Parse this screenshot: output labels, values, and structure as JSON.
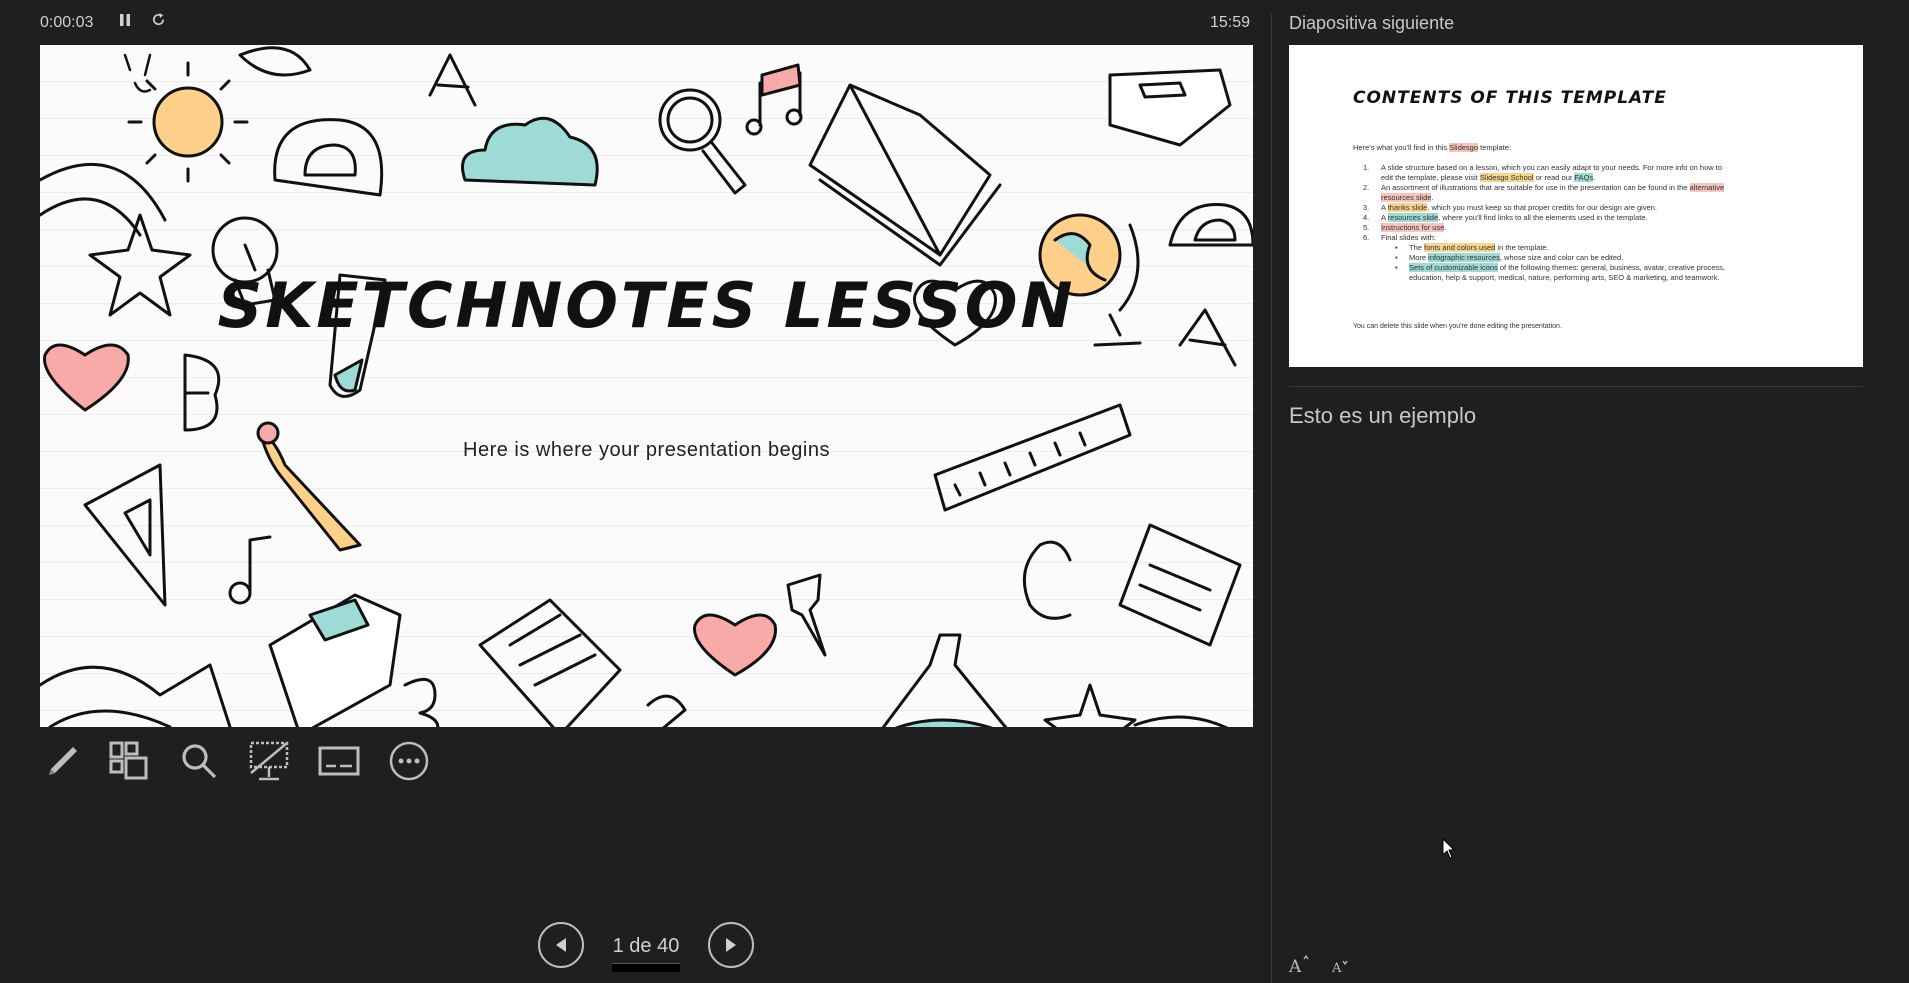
{
  "top_bar": {
    "elapsed_time": "0:00:03",
    "pause_icon": "pause-icon",
    "restart_icon": "restart-timer-icon",
    "clock": "15:59"
  },
  "current_slide": {
    "title": "Sketchnotes Lesson",
    "subtitle": "Here is where your presentation begins"
  },
  "next_slide_panel": {
    "label": "Diapositiva siguiente",
    "preview": {
      "title": "Contents of this template",
      "intro_before": "Here's what you'll find in this ",
      "intro_brand": "Slidesgo",
      "intro_after": " template:",
      "items": [
        {
          "num": "1.",
          "parts": [
            {
              "t": "A slide structure based on a lesson, which you can easily adapt to your needs. For more info on how to edit the template, please visit "
            },
            {
              "t": "Slidesgo School",
              "hl": "yellow"
            },
            {
              "t": " or read our "
            },
            {
              "t": "FAQs",
              "hl": "teal"
            },
            {
              "t": "."
            }
          ]
        },
        {
          "num": "2.",
          "parts": [
            {
              "t": "An assortment of illustrations that are suitable for use in the presentation can be found in the "
            },
            {
              "t": "alternative resources slide",
              "hl": "pink"
            },
            {
              "t": "."
            }
          ]
        },
        {
          "num": "3.",
          "parts": [
            {
              "t": "A "
            },
            {
              "t": "thanks slide",
              "hl": "yellow"
            },
            {
              "t": ", which you must keep so that proper credits for our design are given."
            }
          ]
        },
        {
          "num": "4.",
          "parts": [
            {
              "t": "A "
            },
            {
              "t": "resources slide",
              "hl": "teal"
            },
            {
              "t": ", where you'll find links to all the elements used in the template."
            }
          ]
        },
        {
          "num": "5.",
          "parts": [
            {
              "t": "Instructions for use",
              "hl": "pink"
            },
            {
              "t": "."
            }
          ]
        },
        {
          "num": "6.",
          "parts": [
            {
              "t": "Final slides with:"
            }
          ]
        }
      ],
      "subitems": [
        {
          "parts": [
            {
              "t": "The "
            },
            {
              "t": "fonts and colors used",
              "hl": "yellow"
            },
            {
              "t": " in the template."
            }
          ]
        },
        {
          "parts": [
            {
              "t": "More "
            },
            {
              "t": "infographic resources",
              "hl": "teal"
            },
            {
              "t": ", whose size and color can be edited."
            }
          ]
        },
        {
          "parts": [
            {
              "t": "Sets of customizable icons",
              "hl": "teal"
            },
            {
              "t": " of the following themes: general, business, avatar, creative process, education, help & support, medical, nature, performing arts, SEO & marketing, and teamwork."
            }
          ]
        }
      ],
      "footer": "You can delete this slide when you're done editing the presentation."
    }
  },
  "notes": {
    "text": "Esto es un ejemplo",
    "increase_font_icon": "increase-font-icon",
    "decrease_font_icon": "decrease-font-icon"
  },
  "tools": [
    {
      "name": "pen-tool",
      "icon": "pen-icon"
    },
    {
      "name": "see-all-slides",
      "icon": "slides-grid-icon"
    },
    {
      "name": "zoom-into-slide",
      "icon": "magnifier-icon"
    },
    {
      "name": "black-or-unblack-slideshow",
      "icon": "screen-off-icon"
    },
    {
      "name": "toggle-subtitles",
      "icon": "subtitles-icon"
    },
    {
      "name": "more-slideshow-options",
      "icon": "more-options-icon"
    }
  ],
  "navigation": {
    "page_count": "1 de 40",
    "current_page": 1,
    "total_pages": 40,
    "prev_icon": "previous-slide-icon",
    "next_icon": "next-slide-icon"
  },
  "colors": {
    "background": "#1f1f1f",
    "accent_pink": "#f8aaa8",
    "accent_teal": "#9fdbd6",
    "accent_yellow": "#ffd08a"
  }
}
